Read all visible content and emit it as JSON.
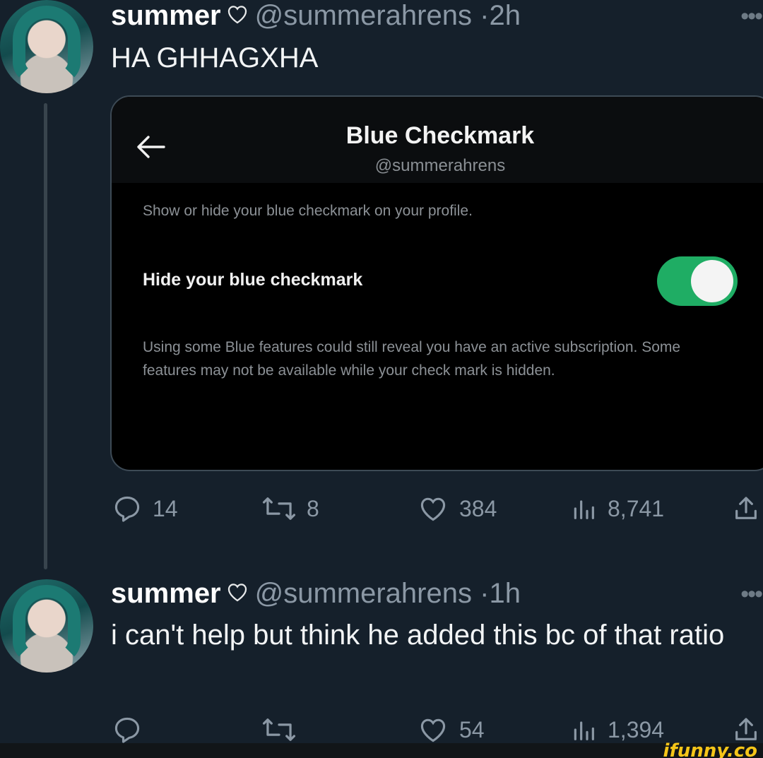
{
  "tweets": [
    {
      "display_name": "summer",
      "handle": "@summerahrens",
      "time": "2h",
      "text": "HA GHHAGXHA",
      "actions": {
        "replies": "14",
        "retweets": "8",
        "likes": "384",
        "views": "8,741"
      }
    },
    {
      "display_name": "summer",
      "handle": "@summerahrens",
      "time": "1h",
      "text": "i can't help but think he added this bc of that ratio",
      "actions": {
        "replies": "",
        "retweets": "",
        "likes": "54",
        "views": "1,394"
      }
    }
  ],
  "separator": "·",
  "more_label": "•••",
  "card": {
    "title": "Blue Checkmark",
    "handle": "@summerahrens",
    "description": "Show or hide your blue checkmark on your profile.",
    "setting_label": "Hide your blue checkmark",
    "toggle_on": true,
    "note": "Using some Blue features could still reveal you have an active subscription. Some features may not be available while your check mark is hidden."
  },
  "watermark": "ifunny.co",
  "colors": {
    "background": "#15202b",
    "toggle_on": "#1fad64",
    "secondary_text": "#8b98a5"
  },
  "icons": [
    "heart-badge-icon",
    "more-icon",
    "back-arrow-icon",
    "reply-icon",
    "retweet-icon",
    "like-icon",
    "views-icon",
    "share-icon"
  ]
}
